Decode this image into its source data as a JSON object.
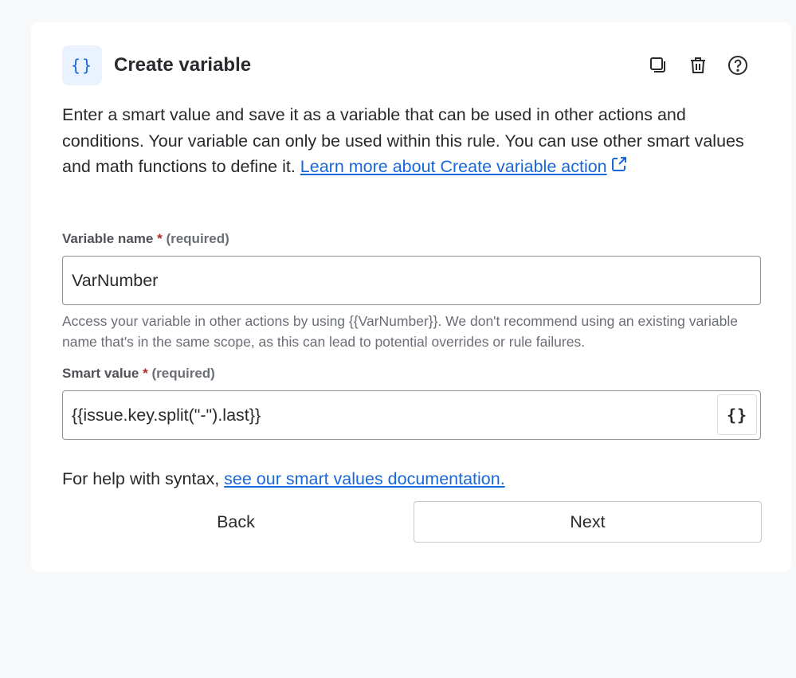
{
  "header": {
    "icon": "curly-braces-icon",
    "icon_text": "{}",
    "title": "Create variable",
    "actions": [
      "duplicate-icon",
      "trash-icon",
      "help-icon"
    ]
  },
  "description": {
    "text": "Enter a smart value and save it as a variable that can be used in other actions and conditions. Your variable can only be used within this rule. You can use other smart values and math functions to define it. ",
    "link_text": "Learn more about Create variable action"
  },
  "variable_name": {
    "label": "Variable name",
    "required_mark": "*",
    "required_text": "(required)",
    "value": "VarNumber",
    "helper": "Access your variable in other actions by using {{VarNumber}}. We don't recommend using an existing variable name that's in the same scope, as this can lead to potential overrides or rule failures."
  },
  "smart_value": {
    "label": "Smart value",
    "required_mark": "*",
    "required_text": "(required)",
    "value": "{{issue.key.split(\"-\").last}}",
    "button_text": "{}"
  },
  "syntax_help": {
    "text": "For help with syntax, ",
    "link_text": "see our smart values documentation."
  },
  "buttons": {
    "back": "Back",
    "next": "Next"
  },
  "colors": {
    "link": "#1868db",
    "required": "#ae2e24",
    "badge_bg": "#e9f2fe"
  }
}
